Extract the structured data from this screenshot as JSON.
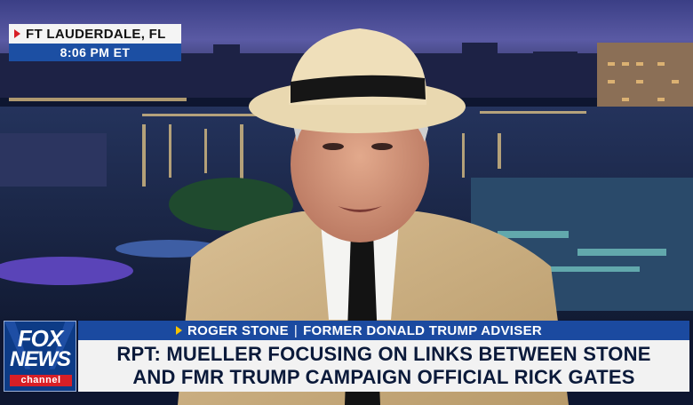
{
  "location_bug": {
    "city": "FT LAUDERDALE, FL",
    "time": "8:06 PM ET"
  },
  "logo": {
    "line1": "FOX",
    "line2": "NEWS",
    "line3": "channel"
  },
  "lower_third": {
    "name": "ROGER STONE",
    "title": "FORMER DONALD TRUMP ADVISER",
    "separator": "|",
    "headline_line1": "RPT: MUELLER FOCUSING ON LINKS BETWEEN STONE",
    "headline_line2": "AND FMR TRUMP CAMPAIGN OFFICIAL RICK GATES"
  },
  "colors": {
    "fox_blue": "#1b4aa0",
    "fox_red": "#d81f26",
    "accent_yellow": "#f6c200"
  }
}
